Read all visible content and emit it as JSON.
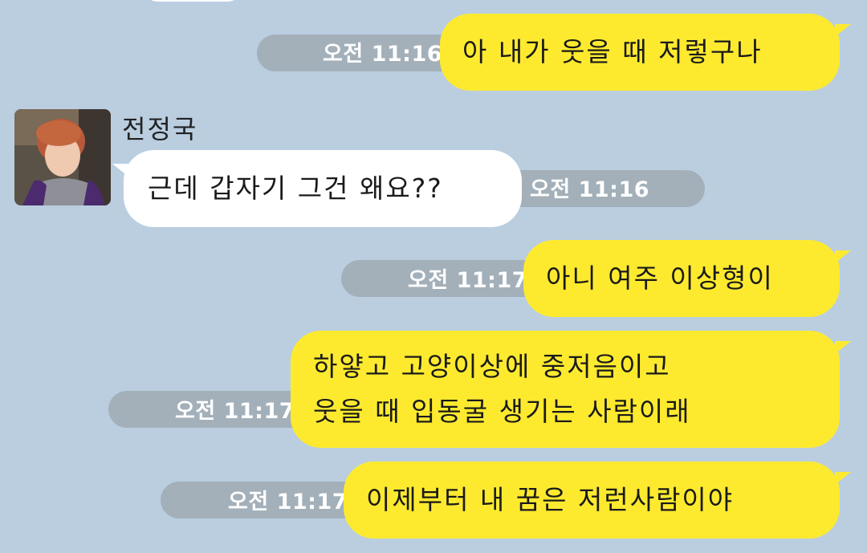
{
  "chat": {
    "sender_name": "전정국",
    "messages": [
      {
        "from": "me",
        "text_lines": [
          "아 내가 웃을 때 저렇구나"
        ],
        "time": "오전 11:16"
      },
      {
        "from": "other",
        "text_lines": [
          "근데 갑자기 그건 왜요??"
        ],
        "time": "오전 11:16"
      },
      {
        "from": "me",
        "text_lines": [
          "아니 여주 이상형이"
        ],
        "time": "오전 11:17"
      },
      {
        "from": "me",
        "text_lines": [
          "하얗고 고양이상에 중저음이고",
          "웃을 때 입동굴 생기는 사람이래"
        ],
        "time": "오전 11:17"
      },
      {
        "from": "me",
        "text_lines": [
          "이제부터 내 꿈은 저런사람이야"
        ],
        "time": "오전 11:17"
      }
    ]
  },
  "colors": {
    "background": "#bacee0",
    "my_bubble": "#fdea2f",
    "other_bubble": "#ffffff",
    "time_pill": "#a3b0ba"
  }
}
